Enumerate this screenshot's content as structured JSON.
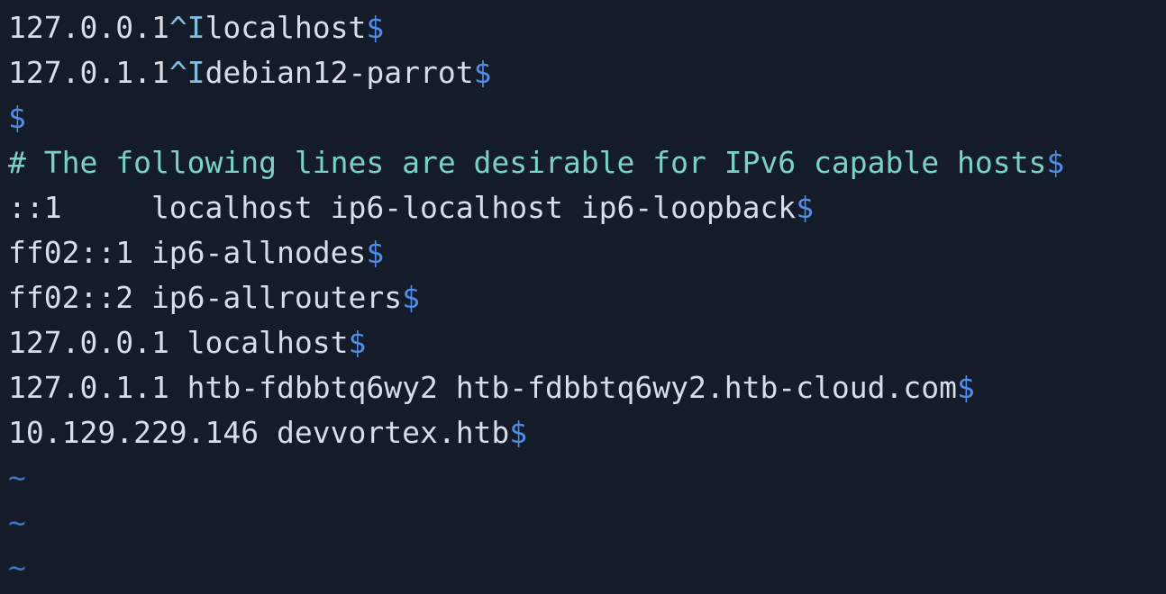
{
  "colors": {
    "background": "#141c29",
    "text": "#d8dde6",
    "control_char": "#7fc0de",
    "end_of_line": "#4f8ee8",
    "comment": "#7ad3c2",
    "empty_line_tilde": "#3d74c4"
  },
  "editor": {
    "lines": [
      {
        "pre": "127.0.0.1",
        "ctrl": "^I",
        "text": "localhost",
        "eol": "$"
      },
      {
        "pre": "127.0.1.1",
        "ctrl": "^I",
        "text": "debian12-parrot",
        "eol": "$"
      },
      {
        "eol": "$"
      },
      {
        "comment": "# The following lines are desirable for IPv6 capable hosts",
        "eol": "$"
      },
      {
        "text": "::1     localhost ip6-localhost ip6-loopback",
        "eol": "$"
      },
      {
        "text": "ff02::1 ip6-allnodes",
        "eol": "$"
      },
      {
        "text": "ff02::2 ip6-allrouters",
        "eol": "$"
      },
      {
        "text": "127.0.0.1 localhost",
        "eol": "$"
      },
      {
        "text": "127.0.1.1 htb-fdbbtq6wy2 htb-fdbbtq6wy2.htb-cloud.com",
        "eol": "$"
      },
      {
        "text": "10.129.229.146 devvortex.htb",
        "eol": "$"
      }
    ],
    "empty_markers": [
      "~",
      "~",
      "~"
    ]
  }
}
